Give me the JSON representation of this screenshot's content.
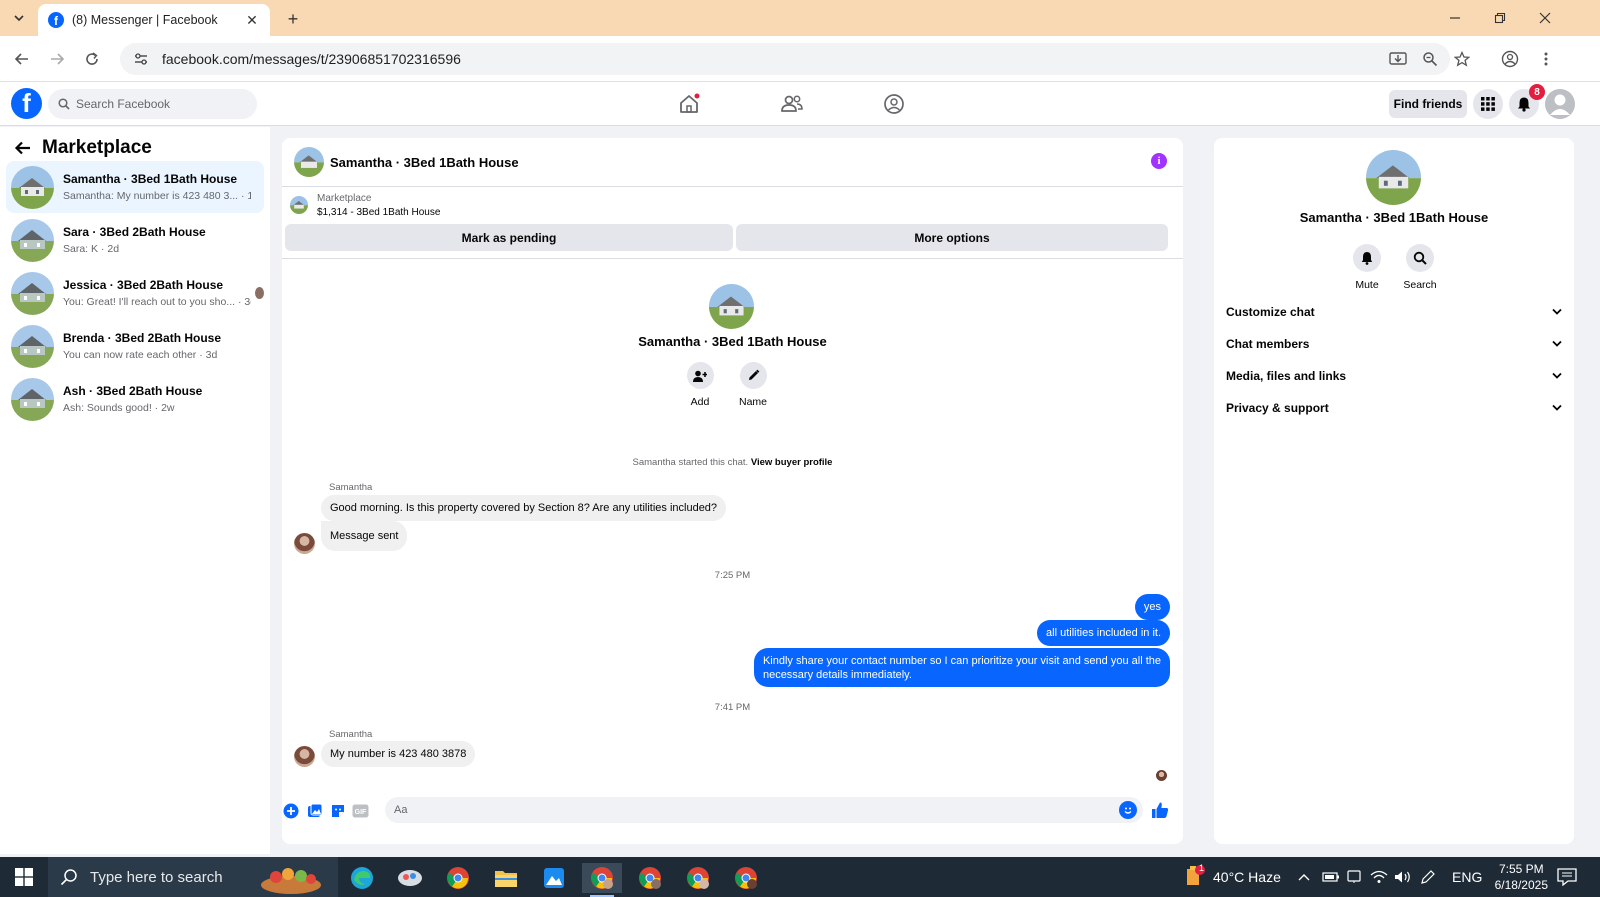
{
  "browser": {
    "tab_title": "(8) Messenger | Facebook",
    "url": "facebook.com/messages/t/23906851702316596",
    "accent_color": "#f9d9b3"
  },
  "fb": {
    "search_placeholder": "Search Facebook",
    "find_friends": "Find friends",
    "notification_count": "8",
    "brand_color": "#0866ff"
  },
  "left": {
    "title": "Marketplace",
    "conversations": [
      {
        "name": "Samantha · 3Bed 1Bath House",
        "preview": "Samantha: My number is 423 480 3... · 14m",
        "active": true
      },
      {
        "name": "Sara · 3Bed 2Bath House",
        "preview": "Sara: K · 2d"
      },
      {
        "name": "Jessica · 3Bed 2Bath House",
        "preview": "You: Great! I'll reach out to you sho... · 3d"
      },
      {
        "name": "Brenda · 3Bed 2Bath House",
        "preview": "You can now rate each other · 3d"
      },
      {
        "name": "Ash · 3Bed 2Bath House",
        "preview": "Ash: Sounds good! · 2w"
      }
    ]
  },
  "chat": {
    "title": "Samantha · 3Bed 1Bath House",
    "listing_source": "Marketplace",
    "listing_title": "$1,314 - 3Bed 1Bath House",
    "mark_pending": "Mark as pending",
    "more_options": "More options",
    "intro_name": "Samantha · 3Bed 1Bath House",
    "add_label": "Add",
    "name_label": "Name",
    "started_text": "Samantha started this chat. ",
    "view_profile": "View buyer profile",
    "sender_name": "Samantha",
    "messages_in_1": [
      "Good morning. Is this property covered by Section 8? Are any utilities included?",
      "Message sent"
    ],
    "time_1": "7:25 PM",
    "messages_out": [
      "yes",
      "all utilities included in it.",
      "Kindly share your contact number so I can prioritize your visit and send you all the",
      "necessary details immediately."
    ],
    "time_2": "7:41 PM",
    "message_in_2": "My number is 423 480 3878",
    "composer_placeholder": "Aa"
  },
  "info_panel": {
    "name": "Samantha · 3Bed 1Bath House",
    "mute": "Mute",
    "search": "Search",
    "sections": [
      "Customize chat",
      "Chat members",
      "Media, files and links",
      "Privacy & support"
    ]
  },
  "taskbar": {
    "search_text": "Type here to search",
    "weather": "40°C  Haze",
    "lang": "ENG",
    "time": "7:55 PM",
    "date": "6/18/2025",
    "weather_badge": "1"
  }
}
